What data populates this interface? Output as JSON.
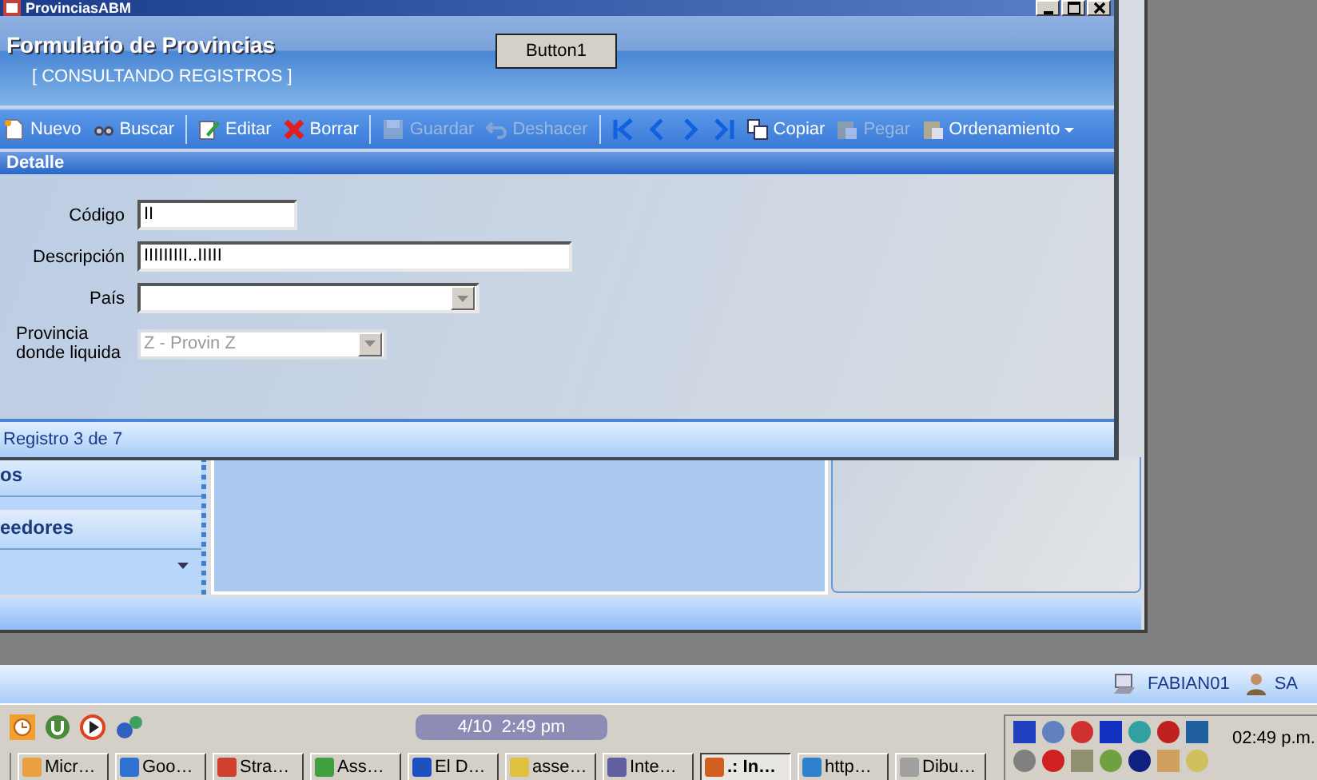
{
  "window": {
    "title": "ProvinciasABM"
  },
  "form": {
    "title": "Formulario de Provincias",
    "mode": "[ CONSULTANDO REGISTROS ]",
    "test_button": "Button1"
  },
  "toolbar": [
    {
      "kind": "button",
      "label": "Nuevo",
      "disabled": false
    },
    {
      "kind": "button",
      "label": "Buscar",
      "disabled": false
    },
    {
      "kind": "separator"
    },
    {
      "kind": "button",
      "label": "Editar",
      "disabled": false
    },
    {
      "kind": "button",
      "label": "Borrar",
      "disabled": false
    },
    {
      "kind": "separator"
    },
    {
      "kind": "button",
      "label": "Guardar",
      "disabled": true
    },
    {
      "kind": "button",
      "label": "Deshacer",
      "disabled": true
    },
    {
      "kind": "separator"
    },
    {
      "kind": "nav",
      "disabled": false
    },
    {
      "kind": "nav",
      "disabled": false
    },
    {
      "kind": "nav",
      "disabled": false
    },
    {
      "kind": "nav",
      "disabled": false
    },
    {
      "kind": "button",
      "label": "Copiar",
      "disabled": false
    },
    {
      "kind": "button",
      "label": "Pegar",
      "disabled": true
    },
    {
      "kind": "menu",
      "label": "Ordenamiento",
      "disabled": false
    }
  ],
  "detail": {
    "title": "Detalle",
    "fields": [
      {
        "kind": "text",
        "label": "Código",
        "value": "II",
        "disabled": false
      },
      {
        "kind": "text",
        "label": "Descripción",
        "value": "IIIIIIIII..IIIII",
        "disabled": false
      },
      {
        "kind": "combo",
        "label": "País",
        "disabled": false
      },
      {
        "kind": "combo",
        "label": "Provincia donde liquida",
        "value": "Z - Provin Z",
        "disabled": true
      }
    ]
  },
  "record_status": "Registro 3 de 7",
  "background_app": {
    "sidebar": [
      {
        "label": "os"
      },
      {
        "label": "eedores"
      }
    ]
  },
  "status_bar": {
    "machine": "FABIAN01",
    "user": "SA"
  },
  "quick_launch": {
    "clock": "4/10  2:49 pm"
  },
  "taskbar": [
    {
      "label": "Micr…",
      "selected": false
    },
    {
      "label": "Goo…",
      "selected": false
    },
    {
      "label": "Stra…",
      "selected": false
    },
    {
      "label": "Ass…",
      "selected": false
    },
    {
      "label": "El D…",
      "selected": false
    },
    {
      "label": "asse…",
      "selected": false
    },
    {
      "label": "Inte…",
      "selected": false
    },
    {
      "label": ".: In…",
      "selected": true
    },
    {
      "label": "http…",
      "selected": false
    },
    {
      "label": "Dibu…",
      "selected": false
    }
  ],
  "tray": {
    "time": "02:49 p.m."
  }
}
